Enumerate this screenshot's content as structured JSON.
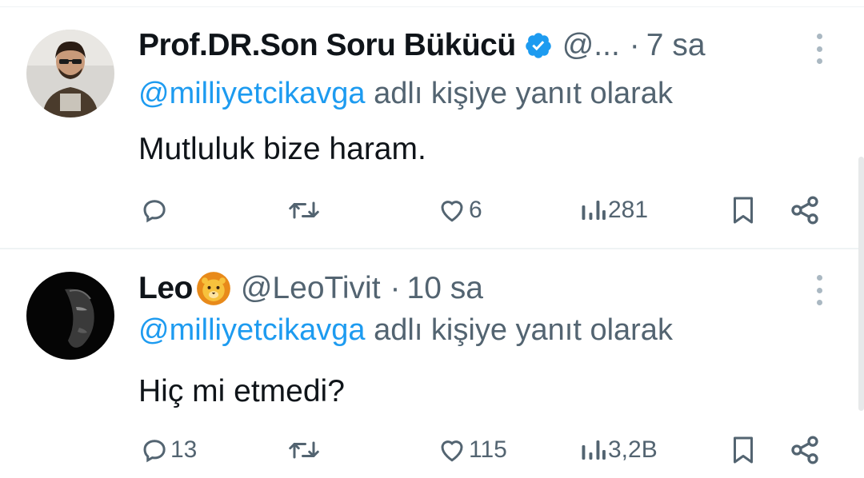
{
  "tweets": [
    {
      "author": {
        "name": "Prof.DR.Son Soru Bükücü",
        "verified": true,
        "handle": "@...",
        "separator": "·",
        "time": "7 sa"
      },
      "reply_to": {
        "mention": "@milliyetcikavga",
        "suffix": " adlı kişiye yanıt olarak"
      },
      "text": "Mutluluk bize haram.",
      "actions": {
        "replies": "",
        "retweets": "",
        "likes": "6",
        "views": "281"
      }
    },
    {
      "author": {
        "name": "Leo",
        "emoji": "🦁",
        "handle": "@LeoTivit",
        "separator": "·",
        "time": "10 sa"
      },
      "reply_to": {
        "mention": "@milliyetcikavga",
        "suffix": " adlı kişiye yanıt olarak"
      },
      "text": "Hiç mi etmedi?",
      "actions": {
        "replies": "13",
        "retweets": "",
        "likes": "115",
        "views": "3,2B"
      }
    }
  ],
  "colors": {
    "accent": "#1d9bf0",
    "secondary_text": "#536471",
    "primary_text": "#0f1419",
    "divider": "#eff3f4"
  },
  "icons": {
    "reply": "reply-icon",
    "retweet": "retweet-icon",
    "like": "heart-icon",
    "views": "views-icon",
    "bookmark": "bookmark-icon",
    "share": "share-icon",
    "more": "more-icon",
    "verified": "verified-badge-icon"
  }
}
